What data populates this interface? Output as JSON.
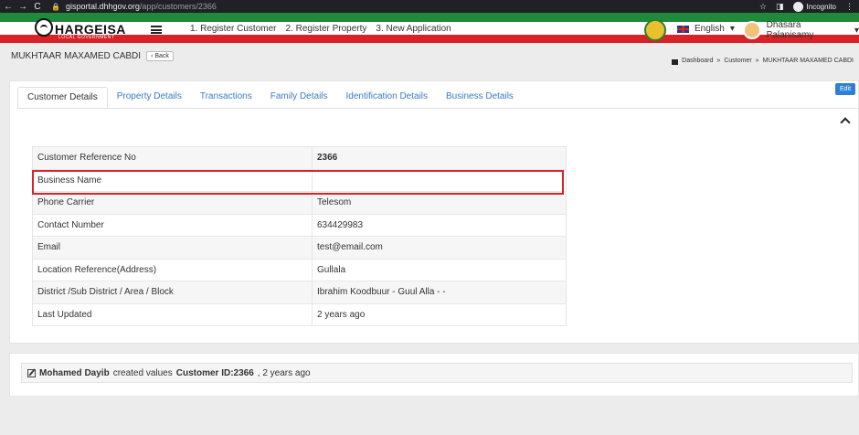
{
  "browser": {
    "url_host": "gisportal.dhhgov.org",
    "url_path": "/app/customers/2366",
    "incognito_label": "Incognito"
  },
  "header": {
    "logo_text": "HARGEISA",
    "logo_sub": "LOCAL GOVERNMENT",
    "nav": [
      "1. Register Customer",
      "2. Register Property",
      "3. New Application"
    ],
    "language": "English",
    "user_name": "Dhasara Palanisamy"
  },
  "page": {
    "title": "MUKHTAAR MAXAMED CABDI",
    "back_label": "Back",
    "breadcrumb": [
      "Dashboard",
      "Customer",
      "MUKHTAAR MAXAMED CABDI"
    ],
    "breadcrumb_sep": "»"
  },
  "tabs": [
    {
      "label": "Customer Details",
      "active": true
    },
    {
      "label": "Property Details",
      "active": false
    },
    {
      "label": "Transactions",
      "active": false
    },
    {
      "label": "Family Details",
      "active": false
    },
    {
      "label": "Identification Details",
      "active": false
    },
    {
      "label": "Business Details",
      "active": false
    }
  ],
  "edit_label": "Edit",
  "details": [
    {
      "label": "Customer Reference No",
      "value": "2366"
    },
    {
      "label": "Business Name",
      "value": ""
    },
    {
      "label": "Phone Carrier",
      "value": "Telesom"
    },
    {
      "label": "Contact Number",
      "value": "634429983"
    },
    {
      "label": "Email",
      "value": "test@email.com"
    },
    {
      "label": "Location Reference(Address)",
      "value": "Gullala"
    },
    {
      "label": "District /Sub District / Area / Block",
      "value": "Ibrahim Koodbuur - Guul Alla - -"
    },
    {
      "label": "Last Updated",
      "value": "2 years ago"
    }
  ],
  "activity": {
    "actor": "Mohamed Dayib",
    "action": "created values",
    "target": "Customer ID:2366",
    "time": ", 2 years ago"
  },
  "colors": {
    "flag_green": "#1f8a3b",
    "flag_red": "#d92127",
    "link_blue": "#3c7bbf",
    "highlight_red": "#d9222a",
    "edit_blue": "#2f7fd6"
  }
}
